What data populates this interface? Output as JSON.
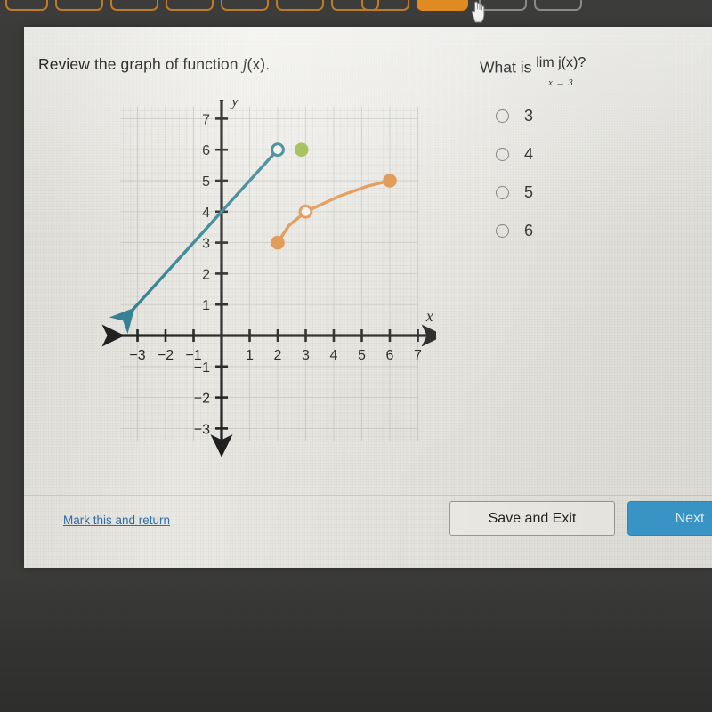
{
  "browser": {
    "tabs": [
      {
        "name": "tab-1",
        "state": "outline"
      },
      {
        "name": "tab-2",
        "state": "outline"
      },
      {
        "name": "tab-3",
        "state": "outline"
      },
      {
        "name": "tab-4",
        "state": "outline"
      },
      {
        "name": "tab-5",
        "state": "outline"
      },
      {
        "name": "tab-6",
        "state": "outline"
      },
      {
        "name": "tab-7",
        "state": "dim"
      },
      {
        "name": "tab-8",
        "state": "active"
      },
      {
        "name": "tab-9",
        "state": "dim"
      },
      {
        "name": "tab-10",
        "state": "dim"
      }
    ],
    "cursor": "pointing-hand-cursor",
    "accent_color": "#e08a22"
  },
  "prompt": {
    "text_before": "Review the graph of function ",
    "function_name": "j",
    "text_after": "(x)."
  },
  "question": {
    "intro": "What is",
    "limit_expr": "lim j(x)?",
    "limit_main": "lim  j(x)?",
    "limit_sub": "x → 3",
    "options": [
      {
        "label": "3",
        "selected": false
      },
      {
        "label": "4",
        "selected": false
      },
      {
        "label": "5",
        "selected": false
      },
      {
        "label": "6",
        "selected": false
      }
    ]
  },
  "footer": {
    "mark_link": "Mark this and return",
    "save_exit_label": "Save and Exit",
    "next_label": "Next",
    "next_color": "#3c9cd0",
    "link_color": "#2f6fa8"
  },
  "chart_data": {
    "type": "line",
    "title": "",
    "xlabel": "x",
    "ylabel": "y",
    "xlim": [
      -3.6,
      7.8
    ],
    "ylim": [
      -3.8,
      7.6
    ],
    "xticks": [
      -3,
      -2,
      -1,
      1,
      2,
      3,
      4,
      5,
      6,
      7
    ],
    "yticks": [
      7,
      6,
      5,
      4,
      3,
      2,
      1,
      -1,
      -2,
      -3
    ],
    "grid": true,
    "grid_color": "#c9c9c4",
    "axis_color": "#1d1d1d",
    "series": [
      {
        "name": "teal-ray",
        "color": "#2f7f92",
        "style": "line-with-arrow",
        "points": [
          [
            -3.2,
            0.8
          ],
          [
            2,
            6
          ]
        ],
        "arrow_at": "start",
        "endpoint_marker": {
          "at": [
            2,
            6
          ],
          "type": "open-circle"
        },
        "y_intercept": 4,
        "slope": 1
      },
      {
        "name": "orange-curve",
        "color": "#e08a3c",
        "style": "curve",
        "points": [
          [
            2,
            3
          ],
          [
            2.4,
            3.55
          ],
          [
            3,
            4
          ],
          [
            4.2,
            4.5
          ],
          [
            5.2,
            4.82
          ],
          [
            6,
            5
          ]
        ],
        "markers": [
          {
            "at": [
              2,
              3
            ],
            "type": "filled-circle"
          },
          {
            "at": [
              3,
              4
            ],
            "type": "open-circle"
          },
          {
            "at": [
              6,
              5
            ],
            "type": "filled-circle"
          }
        ]
      },
      {
        "name": "green-point",
        "color": "#96b83f",
        "style": "point",
        "points": [
          [
            2.85,
            6
          ]
        ],
        "markers": [
          {
            "at": [
              2.85,
              6
            ],
            "type": "filled-circle"
          }
        ]
      }
    ]
  }
}
